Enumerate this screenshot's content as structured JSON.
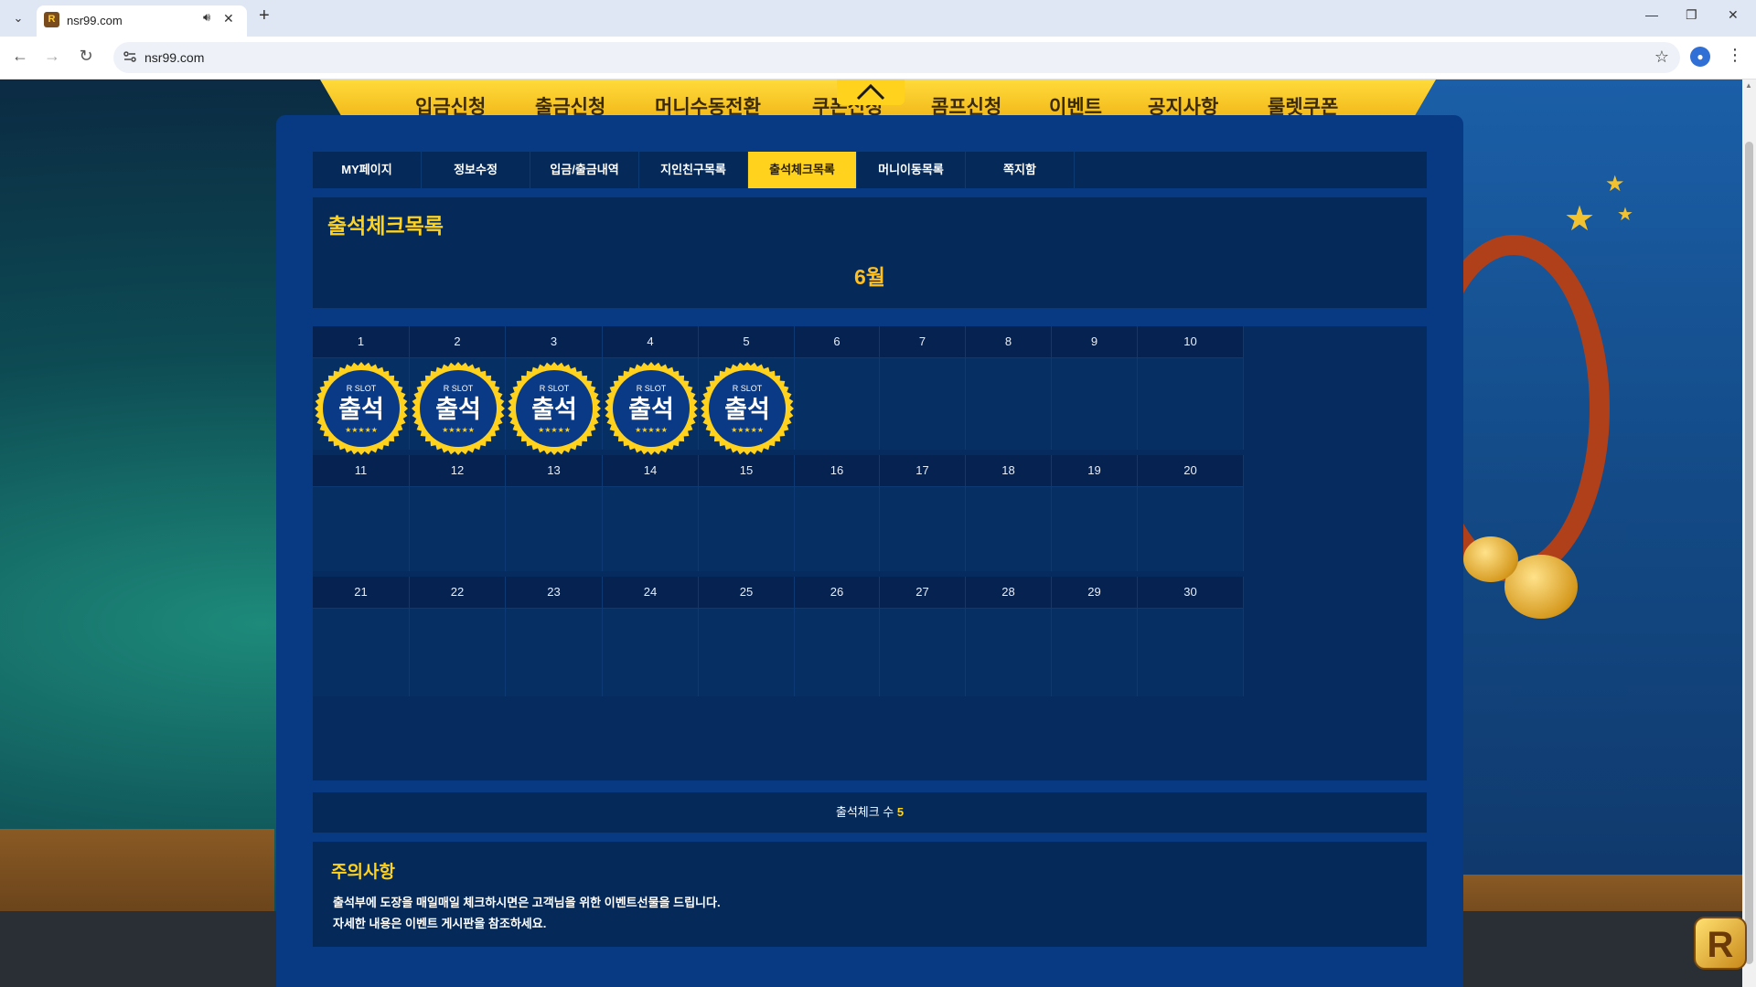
{
  "browser": {
    "tab_title": "nsr99.com",
    "url": "nsr99.com"
  },
  "site_nav": [
    "입금신청",
    "출금신청",
    "머니수동전환",
    "쿠폰신청",
    "콤프신청",
    "이벤트",
    "공지사항",
    "룰렛쿠폰"
  ],
  "mypage_tabs": [
    "MY페이지",
    "정보수정",
    "입금/출금내역",
    "지인친구목록",
    "출석체크목록",
    "머니이동목록",
    "쪽지함"
  ],
  "active_tab": "출석체크목록",
  "page_title": "출석체크목록",
  "month": "6월",
  "calendar": {
    "days": [
      1,
      2,
      3,
      4,
      5,
      6,
      7,
      8,
      9,
      10,
      11,
      12,
      13,
      14,
      15,
      16,
      17,
      18,
      19,
      20,
      21,
      22,
      23,
      24,
      25,
      26,
      27,
      28,
      29,
      30
    ],
    "attended_days": [
      1,
      2,
      3,
      4,
      5
    ],
    "stamp": {
      "brand": "R SLOT",
      "label": "출석",
      "stars": "★★★★★"
    }
  },
  "attendance_count": {
    "label": "출석체크 수",
    "value": "5"
  },
  "notice": {
    "title": "주의사항",
    "lines": [
      "출석부에 도장을 매일매일 체크하시면은 고객님을 위한 이벤트선물을 드립니다.",
      "자세한 내용은 이벤트 게시판을 참조하세요."
    ]
  },
  "colors": {
    "accent": "#ffd21e",
    "panel": "#073a82",
    "stamp_fill": "#0a3a86"
  }
}
